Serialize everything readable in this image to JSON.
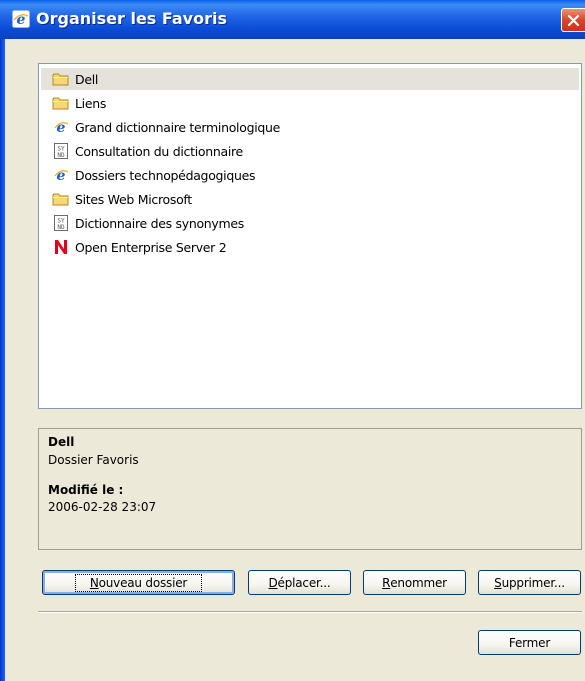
{
  "window": {
    "title": "Organiser les Favoris"
  },
  "favorites": [
    {
      "label": "Dell",
      "icon": "folder-icon",
      "selected": true
    },
    {
      "label": "Liens",
      "icon": "folder-icon"
    },
    {
      "label": "Grand dictionnaire terminologique",
      "icon": "ie-page-icon"
    },
    {
      "label": "Consultation du dictionnaire",
      "icon": "syn-page-icon"
    },
    {
      "label": "Dossiers technopédagogiques",
      "icon": "ie-page-icon"
    },
    {
      "label": "Sites Web Microsoft",
      "icon": "folder-icon"
    },
    {
      "label": "Dictionnaire des synonymes",
      "icon": "syn-page-icon"
    },
    {
      "label": "Open Enterprise Server 2",
      "icon": "novell-icon"
    }
  ],
  "details": {
    "name": "Dell",
    "type": "Dossier Favoris",
    "modified_label": "Modifié le :",
    "modified_value": "2006-02-28 23:07"
  },
  "buttons": {
    "new_folder": {
      "ul": "N",
      "rest": "ouveau dossier"
    },
    "move": {
      "ul": "D",
      "rest": "éplacer..."
    },
    "rename": {
      "ul": "R",
      "rest": "enommer"
    },
    "delete": {
      "ul": "S",
      "rest": "upprimer..."
    },
    "close": "Fermer"
  },
  "colors": {
    "titlebar": "#0A4BD6",
    "dialog_bg": "#ECE9D8",
    "selection_bg": "#E4E2DB",
    "close_button": "#D9462A"
  }
}
